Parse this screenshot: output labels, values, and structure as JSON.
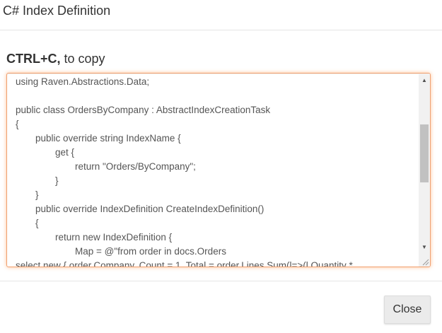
{
  "modal": {
    "title": "C# Index Definition",
    "hint_bold": "CTRL+C,",
    "hint_rest": " to copy"
  },
  "code": {
    "lines": [
      {
        "indent": 0,
        "text": "using Raven.Abstractions.Data;"
      },
      {
        "indent": 0,
        "text": ""
      },
      {
        "indent": 0,
        "text": "public class OrdersByCompany : AbstractIndexCreationTask"
      },
      {
        "indent": 0,
        "text": "{"
      },
      {
        "indent": 1,
        "text": "public override string IndexName {"
      },
      {
        "indent": 2,
        "text": "get {"
      },
      {
        "indent": 3,
        "text": "return \"Orders/ByCompany\";"
      },
      {
        "indent": 2,
        "text": "}"
      },
      {
        "indent": 1,
        "text": "}"
      },
      {
        "indent": 1,
        "text": "public override IndexDefinition CreateIndexDefinition()"
      },
      {
        "indent": 1,
        "text": "{"
      },
      {
        "indent": 2,
        "text": "return new IndexDefinition {"
      },
      {
        "indent": 3,
        "text": "Map = @\"from order in docs.Orders"
      },
      {
        "indent": 0,
        "text": "select new { order.Company, Count = 1, Total = order.Lines.Sum(l=>(l.Quantity *"
      }
    ]
  },
  "footer": {
    "close_label": "Close"
  },
  "colors": {
    "focus_border": "#f0a070",
    "button_bg": "#ebebeb"
  }
}
